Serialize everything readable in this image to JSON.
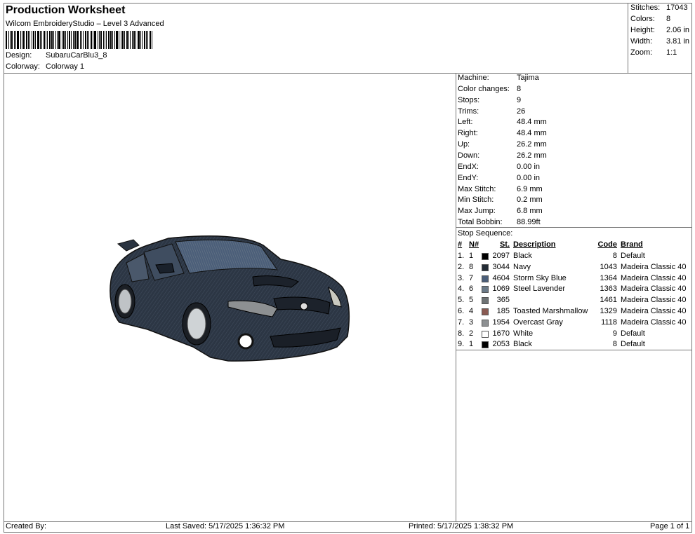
{
  "header": {
    "title": "Production Worksheet",
    "software": "Wilcom EmbroideryStudio – Level 3 Advanced",
    "design_label": "Design:",
    "design_value": "SubaruCarBlu3_8",
    "colorway_label": "Colorway:",
    "colorway_value": "Colorway 1"
  },
  "summary": [
    {
      "label": "Stitches:",
      "value": "17043"
    },
    {
      "label": "Colors:",
      "value": "8"
    },
    {
      "label": "Height:",
      "value": "2.06 in"
    },
    {
      "label": "Width:",
      "value": "3.81 in"
    },
    {
      "label": "Zoom:",
      "value": "1:1"
    }
  ],
  "machine_info": [
    {
      "label": "Machine:",
      "value": "Tajima"
    },
    {
      "label": "Color changes:",
      "value": "8"
    },
    {
      "label": "Stops:",
      "value": "9"
    },
    {
      "label": "Trims:",
      "value": "26"
    },
    {
      "label": "Left:",
      "value": "48.4 mm"
    },
    {
      "label": "Right:",
      "value": "48.4 mm"
    },
    {
      "label": "Up:",
      "value": "26.2 mm"
    },
    {
      "label": "Down:",
      "value": "26.2 mm"
    },
    {
      "label": "EndX:",
      "value": "0.00 in"
    },
    {
      "label": "EndY:",
      "value": "0.00 in"
    },
    {
      "label": "Max Stitch:",
      "value": "6.9 mm"
    },
    {
      "label": "Min Stitch:",
      "value": "0.2 mm"
    },
    {
      "label": "Max Jump:",
      "value": "6.8 mm"
    },
    {
      "label": "Total Bobbin:",
      "value": "88.99ft"
    }
  ],
  "stop_sequence": {
    "label": "Stop Sequence:",
    "headers": {
      "num": "#",
      "n": "N#",
      "st": "St.",
      "description": "Description",
      "code": "Code",
      "brand": "Brand"
    },
    "rows": [
      {
        "num": "1.",
        "n": "1",
        "color": "#000000",
        "st": "2097",
        "description": "Black",
        "code": "8",
        "brand": "Default"
      },
      {
        "num": "2.",
        "n": "8",
        "color": "#232b35",
        "st": "3044",
        "description": "Navy",
        "code": "1043",
        "brand": "Madeira Classic 40"
      },
      {
        "num": "3.",
        "n": "7",
        "color": "#4b5e79",
        "st": "4604",
        "description": "Storm Sky Blue",
        "code": "1364",
        "brand": "Madeira Classic 40"
      },
      {
        "num": "4.",
        "n": "6",
        "color": "#6b7a88",
        "st": "1069",
        "description": "Steel Lavender",
        "code": "1363",
        "brand": "Madeira Classic 40"
      },
      {
        "num": "5.",
        "n": "5",
        "color": "#6e7375",
        "st": "365",
        "description": "",
        "code": "1461",
        "brand": "Madeira Classic 40"
      },
      {
        "num": "6.",
        "n": "4",
        "color": "#8a5a52",
        "st": "185",
        "description": "Toasted Marshmallow",
        "code": "1329",
        "brand": "Madeira Classic 40"
      },
      {
        "num": "7.",
        "n": "3",
        "color": "#8d9092",
        "st": "1954",
        "description": "Overcast Gray",
        "code": "1118",
        "brand": "Madeira Classic 40"
      },
      {
        "num": "8.",
        "n": "2",
        "color": "#ffffff",
        "st": "1670",
        "description": "White",
        "code": "9",
        "brand": "Default"
      },
      {
        "num": "9.",
        "n": "1",
        "color": "#000000",
        "st": "2053",
        "description": "Black",
        "code": "8",
        "brand": "Default"
      }
    ]
  },
  "footer": {
    "created_by": "Created By:",
    "last_saved": "Last Saved: 5/17/2025 1:36:32 PM",
    "printed": "Printed: 5/17/2025 1:38:32 PM",
    "page": "Page 1 of 1"
  }
}
